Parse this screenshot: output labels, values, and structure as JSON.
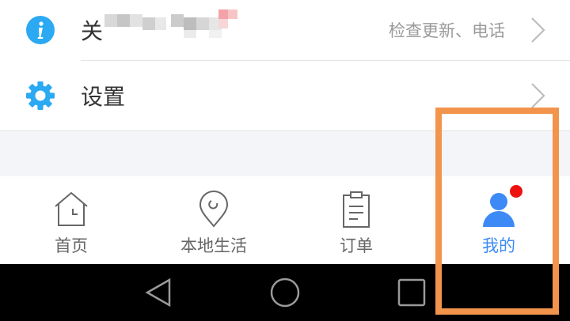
{
  "menu": {
    "about": {
      "title": "关",
      "detail": "检查更新、电话"
    },
    "settings": {
      "title": "设置"
    }
  },
  "tabs": [
    {
      "label": "首页",
      "icon": "home-icon",
      "active": false
    },
    {
      "label": "本地生活",
      "icon": "location-pin-icon",
      "active": false
    },
    {
      "label": "订单",
      "icon": "order-clipboard-icon",
      "active": false
    },
    {
      "label": "我的",
      "icon": "profile-icon",
      "active": true,
      "badge": true
    }
  ],
  "colors": {
    "accent": "#3d8af7",
    "info_icon": "#2ba9f2",
    "badge": "#ee1111",
    "highlight": "#f2944c"
  },
  "system_nav": [
    "back-icon",
    "home-circle-icon",
    "recents-square-icon"
  ]
}
